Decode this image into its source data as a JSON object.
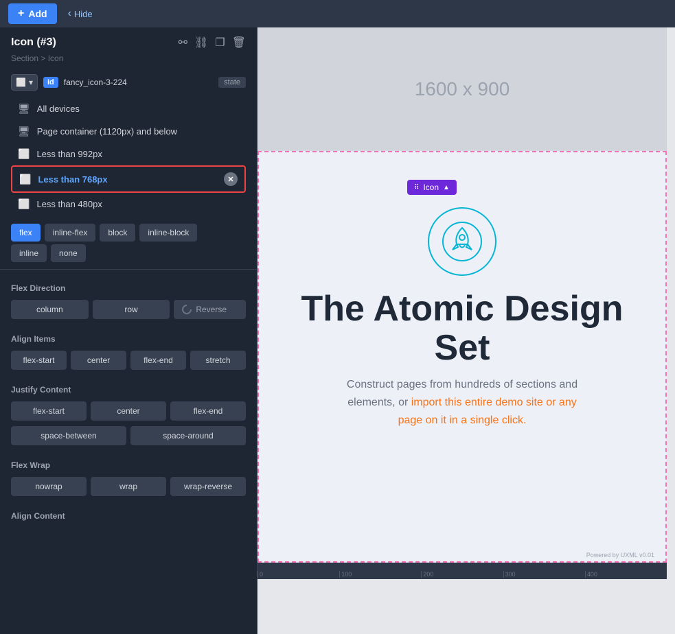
{
  "topbar": {
    "add_label": "Add",
    "hide_label": "Hide"
  },
  "panel": {
    "title": "Icon (#3)",
    "breadcrumb": "Section > Icon",
    "id_badge": "id",
    "id_value": "fancy_icon-3-224",
    "state_label": "state",
    "icons": {
      "hierarchy": "⚬",
      "link": "🔗",
      "copy": "⧉",
      "trash": "🗑"
    }
  },
  "device_options": [
    {
      "label": "All devices",
      "icon": "🖥"
    },
    {
      "label": "Page container (1120px) and below",
      "icon": "🖥"
    },
    {
      "label": "Less than 992px",
      "icon": "🖱"
    },
    {
      "label": "Less than 768px",
      "icon": "📱",
      "selected": true
    },
    {
      "label": "Less than 480px",
      "icon": "📱"
    }
  ],
  "display_buttons": [
    {
      "label": "flex",
      "active": true
    },
    {
      "label": "inline-flex",
      "active": false
    },
    {
      "label": "block",
      "active": false
    },
    {
      "label": "inline-block",
      "active": false
    },
    {
      "label": "inline",
      "active": false
    },
    {
      "label": "none",
      "active": false
    }
  ],
  "flex_direction": {
    "label": "Flex Direction",
    "buttons": [
      "column",
      "row"
    ],
    "reverse_label": "Reverse"
  },
  "align_items": {
    "label": "Align Items",
    "buttons": [
      "flex-start",
      "center",
      "flex-end",
      "stretch"
    ]
  },
  "justify_content": {
    "label": "Justify Content",
    "row1": [
      "flex-start",
      "center",
      "flex-end"
    ],
    "row2": [
      "space-between",
      "space-around"
    ]
  },
  "flex_wrap": {
    "label": "Flex Wrap",
    "buttons": [
      "nowrap",
      "wrap",
      "wrap-reverse"
    ]
  },
  "align_content": {
    "label": "Align Content"
  },
  "canvas": {
    "placeholder_size": "1600 x 900",
    "icon_tag_label": "Icon",
    "heading": "The Atomic Design Set",
    "subtext": "Construct pages from hundreds of sections and elements, or import this entire demo site or any page on it in a single click.",
    "powered": "Powered by UXML v0.01"
  },
  "ruler": {
    "marks": [
      "0",
      "100",
      "200",
      "300",
      "400"
    ]
  }
}
